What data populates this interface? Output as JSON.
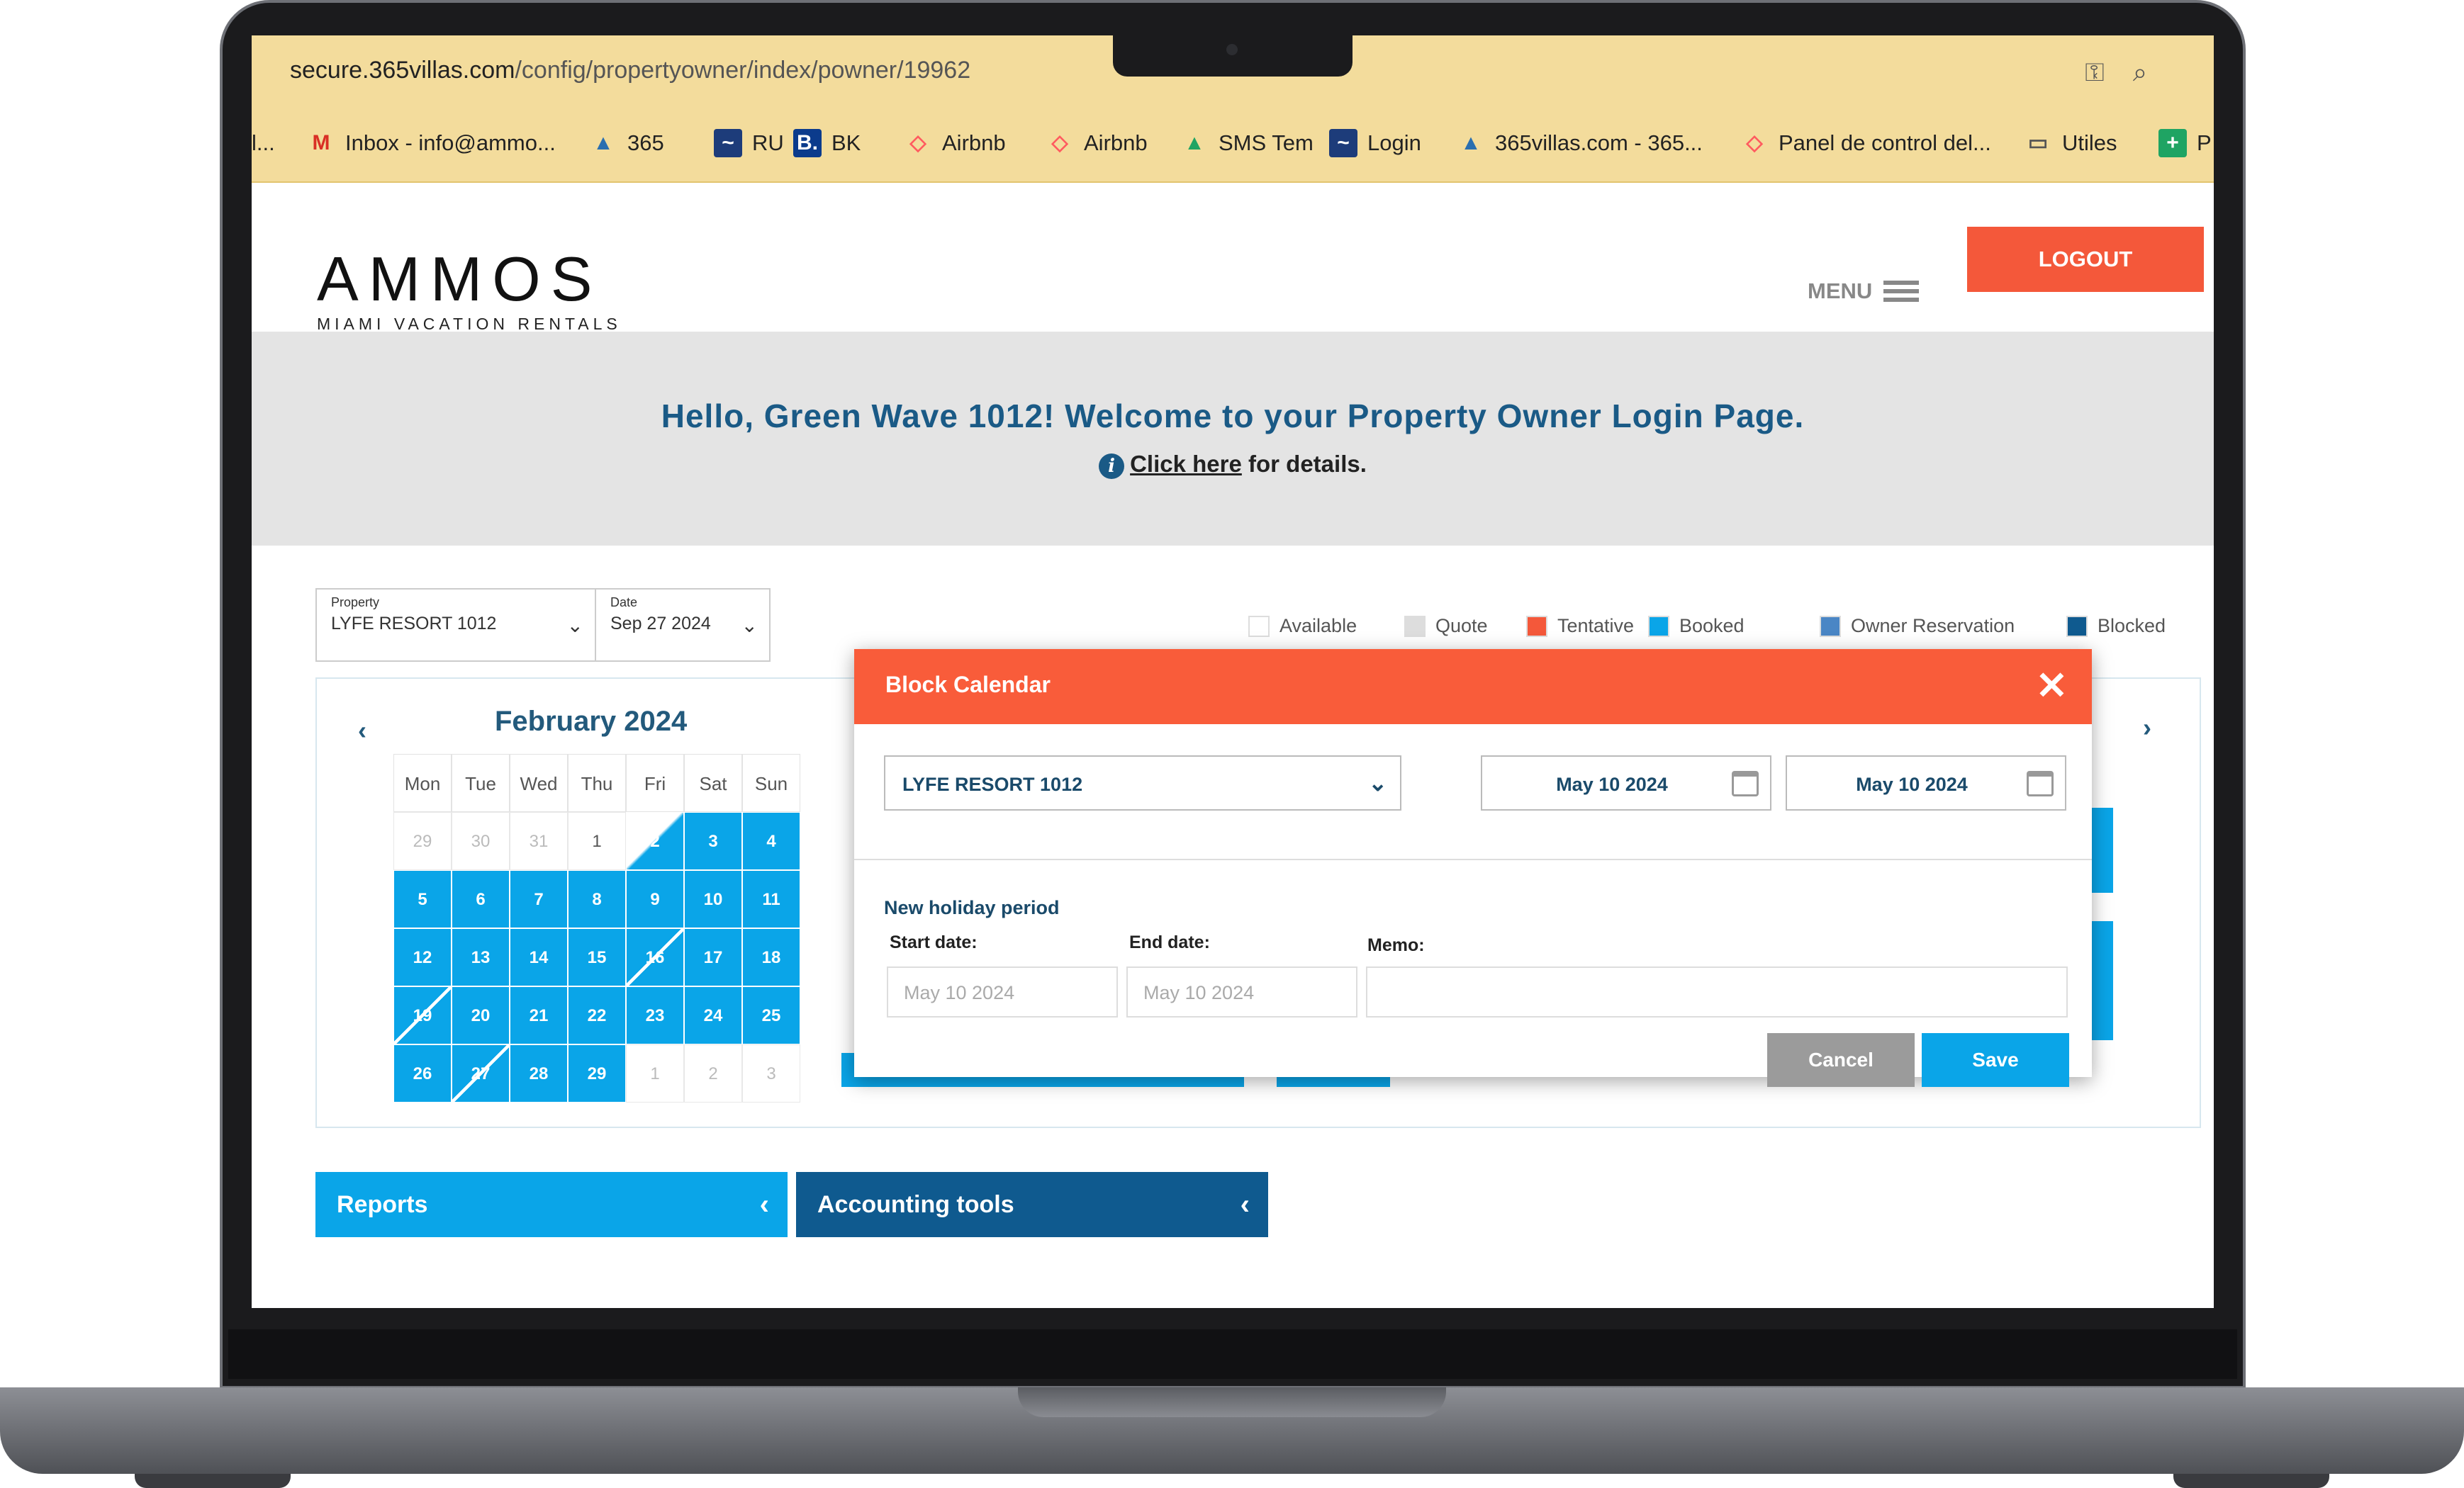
{
  "browser": {
    "url_host": "secure.365villas.com",
    "url_path": "/config/propertyowner/index/powner/19962",
    "bookmarks": [
      {
        "label": "l...",
        "icon": "partial-icon"
      },
      {
        "label": "Inbox - info@ammo...",
        "icon": "gmail-icon"
      },
      {
        "label": "365",
        "icon": "365-icon"
      },
      {
        "label": "RU",
        "icon": "ru-icon"
      },
      {
        "label": "BK",
        "icon": "booking-icon"
      },
      {
        "label": "Airbnb",
        "icon": "airbnb-icon"
      },
      {
        "label": "Airbnb",
        "icon": "airbnb-icon"
      },
      {
        "label": "SMS Tem",
        "icon": "google-drive-icon"
      },
      {
        "label": "Login",
        "icon": "ru-icon"
      },
      {
        "label": "365villas.com - 365...",
        "icon": "365-icon"
      },
      {
        "label": "Panel de control del...",
        "icon": "airbnb-icon"
      },
      {
        "label": "Utiles",
        "icon": "folder-icon"
      },
      {
        "label": "P",
        "icon": "sheets-icon"
      }
    ]
  },
  "header": {
    "logo_text": "AMMOS",
    "logo_sub": "MIAMI VACATION RENTALS",
    "menu_label": "MENU",
    "logout_label": "LOGOUT"
  },
  "banner": {
    "welcome": "Hello, Green Wave 1012! Welcome to your Property Owner Login Page.",
    "details_link": "Click here",
    "details_suffix": "for details."
  },
  "filters": {
    "property_label": "Property",
    "property_value": "LYFE RESORT 1012",
    "date_label": "Date",
    "date_value": "Sep 27 2024"
  },
  "legend": [
    {
      "label": "Available",
      "color": "#ffffff"
    },
    {
      "label": "Quote",
      "color": "#dddddd"
    },
    {
      "label": "Tentative",
      "color": "#f4583a"
    },
    {
      "label": "Booked",
      "color": "#0aa5e8"
    },
    {
      "label": "Owner Reservation",
      "color": "#4a86c5"
    },
    {
      "label": "Blocked",
      "color": "#0f5a8f"
    }
  ],
  "calendar": {
    "month": "February 2024",
    "weekdays": [
      "Mon",
      "Tue",
      "Wed",
      "Thu",
      "Fri",
      "Sat",
      "Sun"
    ],
    "days": [
      {
        "n": "29",
        "s": "o"
      },
      {
        "n": "30",
        "s": "o"
      },
      {
        "n": "31",
        "s": "o"
      },
      {
        "n": "1",
        "s": "w"
      },
      {
        "n": "2",
        "s": "split"
      },
      {
        "n": "3",
        "s": "b"
      },
      {
        "n": "4",
        "s": "b"
      },
      {
        "n": "5",
        "s": "b"
      },
      {
        "n": "6",
        "s": "b"
      },
      {
        "n": "7",
        "s": "b"
      },
      {
        "n": "8",
        "s": "b"
      },
      {
        "n": "9",
        "s": "b"
      },
      {
        "n": "10",
        "s": "b"
      },
      {
        "n": "11",
        "s": "b"
      },
      {
        "n": "12",
        "s": "b"
      },
      {
        "n": "13",
        "s": "b"
      },
      {
        "n": "14",
        "s": "b"
      },
      {
        "n": "15",
        "s": "b"
      },
      {
        "n": "16",
        "s": "split2"
      },
      {
        "n": "17",
        "s": "b"
      },
      {
        "n": "18",
        "s": "b"
      },
      {
        "n": "19",
        "s": "split2"
      },
      {
        "n": "20",
        "s": "b"
      },
      {
        "n": "21",
        "s": "b"
      },
      {
        "n": "22",
        "s": "b"
      },
      {
        "n": "23",
        "s": "b"
      },
      {
        "n": "24",
        "s": "b"
      },
      {
        "n": "25",
        "s": "b"
      },
      {
        "n": "26",
        "s": "b"
      },
      {
        "n": "27",
        "s": "split2"
      },
      {
        "n": "28",
        "s": "b"
      },
      {
        "n": "29",
        "s": "b"
      },
      {
        "n": "1",
        "s": "o"
      },
      {
        "n": "2",
        "s": "o"
      },
      {
        "n": "3",
        "s": "o"
      }
    ]
  },
  "panels": {
    "reports": "Reports",
    "accounting": "Accounting tools"
  },
  "modal": {
    "title": "Block Calendar",
    "property": "LYFE RESORT 1012",
    "date_from": "May 10 2024",
    "date_to": "May 10 2024",
    "section_title": "New holiday period",
    "start_label": "Start date:",
    "end_label": "End date:",
    "memo_label": "Memo:",
    "start_value": "May 10 2024",
    "end_value": "May 10 2024",
    "memo_value": "",
    "cancel_label": "Cancel",
    "save_label": "Save"
  }
}
